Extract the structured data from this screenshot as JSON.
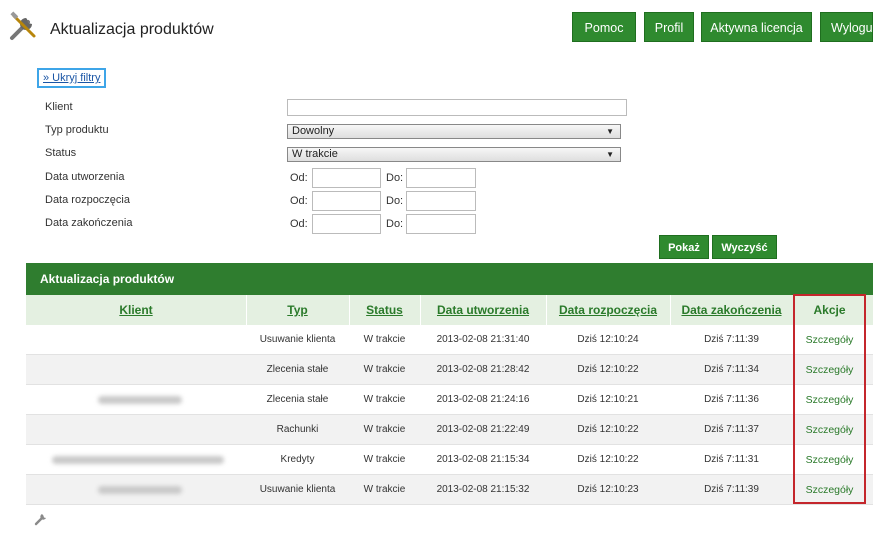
{
  "header": {
    "title": "Aktualizacja produktów",
    "nav": [
      "Pomoc",
      "Profil",
      "Aktywna licencja",
      "Wylogu"
    ]
  },
  "filters": {
    "toggle_label": "» Ukryj filtry",
    "client_label": "Klient",
    "client_value": "",
    "type_label": "Typ produktu",
    "type_value": "Dowolny",
    "status_label": "Status",
    "status_value": "W trakcie",
    "created_label": "Data utworzenia",
    "started_label": "Data rozpoczęcia",
    "ended_label": "Data zakończenia",
    "from_label": "Od:",
    "to_label": "Do:",
    "show_button": "Pokaż",
    "clear_button": "Wyczyść"
  },
  "table": {
    "title": "Aktualizacja produktów",
    "columns": [
      "Klient",
      "Typ",
      "Status",
      "Data utworzenia",
      "Data rozpoczęcia",
      "Data zakończenia",
      "Akcje"
    ],
    "rows": [
      {
        "type": "Usuwanie klienta",
        "status": "W trakcie",
        "created": "2013-02-08 21:31:40",
        "started": "Dziś 12:10:24",
        "ended": "Dziś 7:11:39",
        "action": "Szczegóły"
      },
      {
        "type": "Zlecenia stałe",
        "status": "W trakcie",
        "created": "2013-02-08 21:28:42",
        "started": "Dziś 12:10:22",
        "ended": "Dziś 7:11:34",
        "action": "Szczegóły"
      },
      {
        "type": "Zlecenia stałe",
        "status": "W trakcie",
        "created": "2013-02-08 21:24:16",
        "started": "Dziś 12:10:21",
        "ended": "Dziś 7:11:36",
        "action": "Szczegóły"
      },
      {
        "type": "Rachunki",
        "status": "W trakcie",
        "created": "2013-02-08 21:22:49",
        "started": "Dziś 12:10:22",
        "ended": "Dziś 7:11:37",
        "action": "Szczegóły"
      },
      {
        "type": "Kredyty",
        "status": "W trakcie",
        "created": "2013-02-08 21:15:34",
        "started": "Dziś 12:10:22",
        "ended": "Dziś 7:11:31",
        "action": "Szczegóły"
      },
      {
        "type": "Usuwanie klienta",
        "status": "W trakcie",
        "created": "2013-02-08 21:15:32",
        "started": "Dziś 12:10:23",
        "ended": "Dziś 7:11:39",
        "action": "Szczegóły"
      }
    ]
  },
  "colors": {
    "green": "#2f8a2f",
    "table_header_bg": "#e4f0e1",
    "highlight_red": "#c4262c",
    "focus_blue": "#3ea5e8"
  },
  "icons": {
    "logo": "tools-icon",
    "footer": "wrench-icon"
  }
}
